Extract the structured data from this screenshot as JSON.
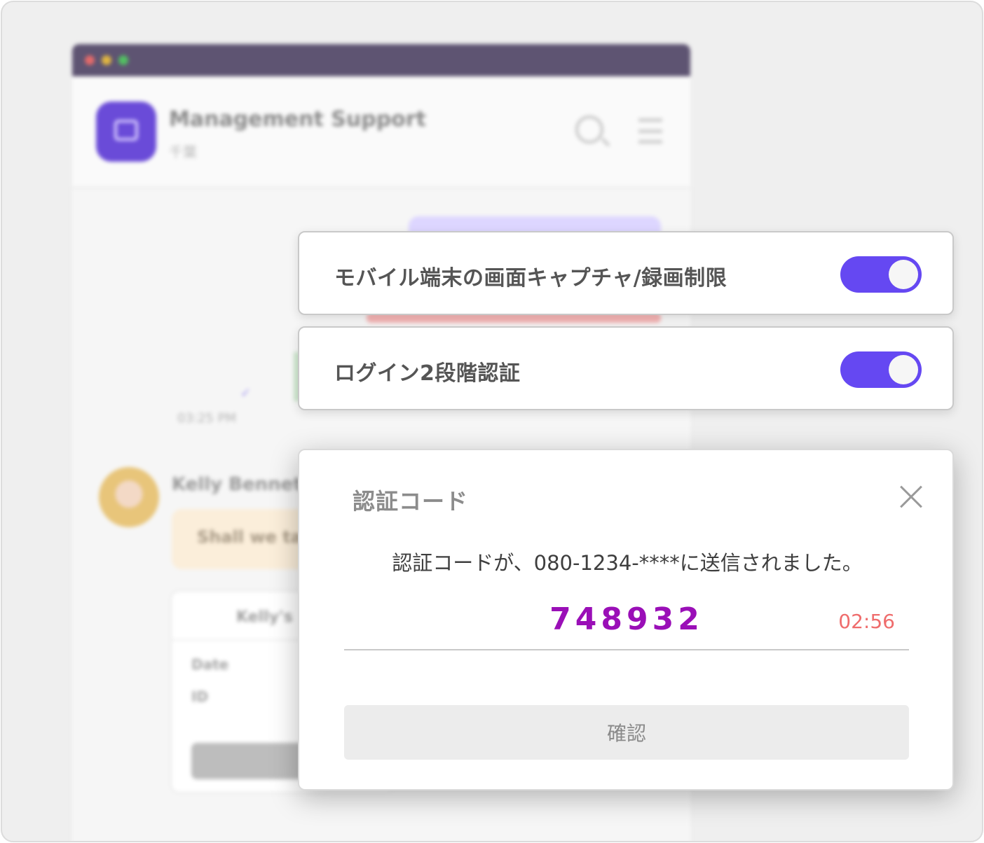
{
  "background_app": {
    "title": "Management Support",
    "subtitle": "千葉",
    "time": "03:25 PM",
    "sender": "Kelly Bennett",
    "message": "Shall we ta",
    "card_title": "Kelly's",
    "card_rows": [
      "Date",
      "ID"
    ],
    "window_dots": [
      "#e36a6a",
      "#e0b541",
      "#52c062"
    ]
  },
  "settings": [
    {
      "label": "モバイル端末の画面キャプチャ/録画制限",
      "enabled": true
    },
    {
      "label": "ログイン2段階認証",
      "enabled": true
    }
  ],
  "dialog": {
    "title": "認証コード",
    "message": "認証コードが、080-1234-****に送信されました。",
    "code": "748932",
    "countdown": "02:56",
    "confirm_label": "確認"
  },
  "colors": {
    "toggle_on": "#6548f2",
    "code": "#9a0fb7",
    "countdown": "#ef6c6c"
  }
}
